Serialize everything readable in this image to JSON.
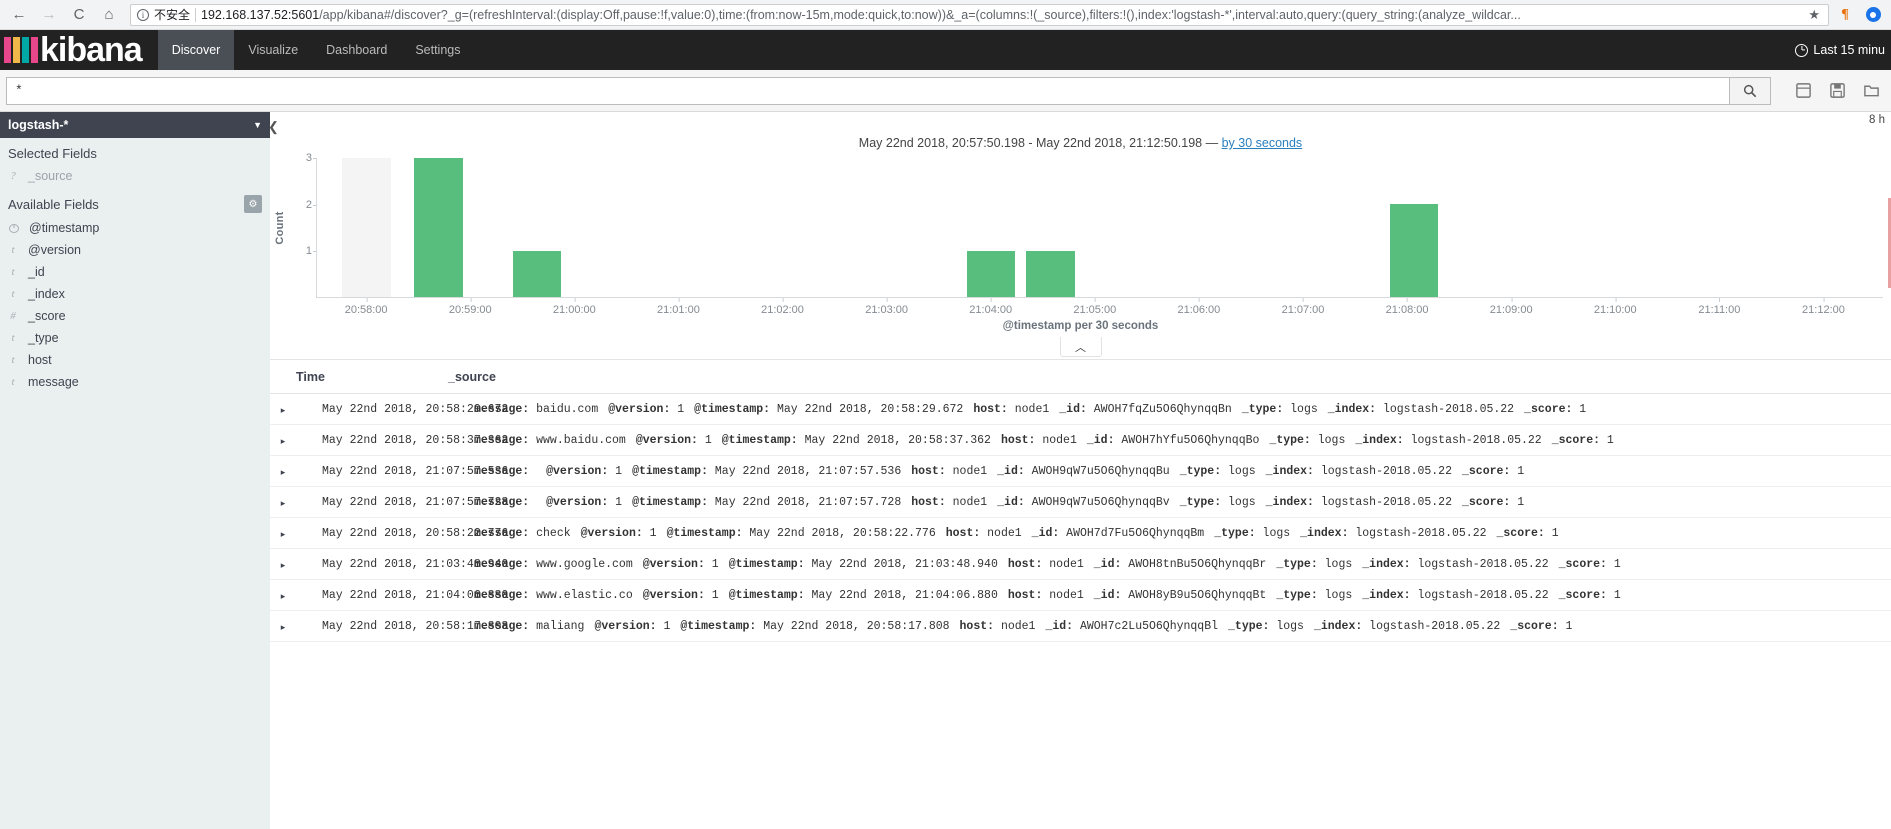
{
  "browser": {
    "back_icon": "back-arrow",
    "forward_icon": "forward-arrow",
    "reload_icon": "reload",
    "home_icon": "home",
    "insecure_label": "不安全",
    "url_host": "192.168.137.52:5601",
    "url_rest": "/app/kibana#/discover?_g=(refreshInterval:(display:Off,pause:!f,value:0),time:(from:now-15m,mode:quick,to:now))&_a=(columns:!(_source),filters:!(),index:'logstash-*',interval:auto,query:(query_string:(analyze_wildcar...",
    "star_icon": "★",
    "ext1_icon": "¶",
    "ext2_icon": "extension-blue"
  },
  "nav": {
    "logo_text": "kibana",
    "logo_colors": [
      "#e8488b",
      "#f0b849",
      "#00a9a5",
      "#e8488b",
      "#ffffff"
    ],
    "tabs": [
      {
        "label": "Discover",
        "active": true
      },
      {
        "label": "Visualize",
        "active": false
      },
      {
        "label": "Dashboard",
        "active": false
      },
      {
        "label": "Settings",
        "active": false
      }
    ],
    "time_picker": "Last 15 minu"
  },
  "search": {
    "value": "*",
    "placeholder": "",
    "go_icon": "search-icon",
    "actions": [
      {
        "name": "new-search-icon",
        "glyph": "▤"
      },
      {
        "name": "save-search-icon",
        "glyph": "▥"
      },
      {
        "name": "open-search-icon",
        "glyph": "▣"
      }
    ]
  },
  "sidebar": {
    "index_pattern": "logstash-*",
    "selected_fields_label": "Selected Fields",
    "available_fields_label": "Available Fields",
    "gear_icon": "gear-icon",
    "selected_fields": [
      {
        "type": "?",
        "name": "_source"
      }
    ],
    "available_fields": [
      {
        "type": "clock",
        "name": "@timestamp"
      },
      {
        "type": "t",
        "name": "@version"
      },
      {
        "type": "t",
        "name": "_id"
      },
      {
        "type": "t",
        "name": "_index"
      },
      {
        "type": "#",
        "name": "_score"
      },
      {
        "type": "t",
        "name": "_type"
      },
      {
        "type": "t",
        "name": "host"
      },
      {
        "type": "t",
        "name": "message"
      }
    ],
    "collapse_icon": "chevron-left-icon"
  },
  "chart_data": {
    "type": "bar",
    "title": "May 22nd 2018, 20:57:50.198 - May 22nd 2018, 21:12:50.198 — ",
    "title_link": "by 30 seconds",
    "range_start": "May 22nd 2018, 20:57:50.198",
    "range_end": "May 22nd 2018, 21:12:50.198",
    "interval_label": "by 30 seconds",
    "xlabel": "@timestamp per 30 seconds",
    "ylabel": "Count",
    "ylim": [
      0,
      3
    ],
    "yticks": [
      1,
      2,
      3
    ],
    "xticks": [
      "20:58:00",
      "20:59:00",
      "21:00:00",
      "21:01:00",
      "21:02:00",
      "21:03:00",
      "21:04:00",
      "21:05:00",
      "21:06:00",
      "21:07:00",
      "21:08:00",
      "21:09:00",
      "21:10:00",
      "21:11:00",
      "21:12:00"
    ],
    "x": [
      "20:58:00",
      "20:58:30",
      "20:59:00",
      "21:03:30",
      "21:04:00",
      "21:07:30"
    ],
    "values": [
      3,
      3,
      1,
      1,
      1,
      2
    ],
    "bar_color": "#57be7d",
    "hover_bar_color": "#f4f4f4",
    "grid": false,
    "bars": [
      {
        "x_pct": 1.6,
        "value": 3,
        "hover": true
      },
      {
        "x_pct": 6.2,
        "value": 3,
        "hover": false
      },
      {
        "x_pct": 12.5,
        "value": 1,
        "hover": false
      },
      {
        "x_pct": 41.5,
        "value": 1,
        "hover": false
      },
      {
        "x_pct": 45.3,
        "value": 1,
        "hover": false
      },
      {
        "x_pct": 68.5,
        "value": 2,
        "hover": false
      }
    ]
  },
  "collapse_chart_icon": "chevron-up-icon",
  "table": {
    "headers": {
      "time": "Time",
      "source": "_source"
    },
    "expand_icon": "▸",
    "rows": [
      {
        "time": "May 22nd 2018, 20:58:29.672",
        "fields": [
          {
            "k": "message:",
            "v": "baidu.com"
          },
          {
            "k": "@version:",
            "v": "1"
          },
          {
            "k": "@timestamp:",
            "v": "May 22nd 2018, 20:58:29.672"
          },
          {
            "k": "host:",
            "v": "node1"
          },
          {
            "k": "_id:",
            "v": "AWOH7fqZu5O6QhynqqBn"
          },
          {
            "k": "_type:",
            "v": "logs"
          },
          {
            "k": "_index:",
            "v": "logstash-2018.05.22"
          },
          {
            "k": "_score:",
            "v": "1"
          }
        ]
      },
      {
        "time": "May 22nd 2018, 20:58:37.362",
        "fields": [
          {
            "k": "message:",
            "v": "www.baidu.com"
          },
          {
            "k": "@version:",
            "v": "1"
          },
          {
            "k": "@timestamp:",
            "v": "May 22nd 2018, 20:58:37.362"
          },
          {
            "k": "host:",
            "v": "node1"
          },
          {
            "k": "_id:",
            "v": "AWOH7hYfu5O6QhynqqBo"
          },
          {
            "k": "_type:",
            "v": "logs"
          },
          {
            "k": "_index:",
            "v": "logstash-2018.05.22"
          },
          {
            "k": "_score:",
            "v": "1"
          }
        ]
      },
      {
        "time": "May 22nd 2018, 21:07:57.536",
        "fields": [
          {
            "k": "message:",
            "v": ""
          },
          {
            "k": "@version:",
            "v": "1"
          },
          {
            "k": "@timestamp:",
            "v": "May 22nd 2018, 21:07:57.536"
          },
          {
            "k": "host:",
            "v": "node1"
          },
          {
            "k": "_id:",
            "v": "AWOH9qW7u5O6QhynqqBu"
          },
          {
            "k": "_type:",
            "v": "logs"
          },
          {
            "k": "_index:",
            "v": "logstash-2018.05.22"
          },
          {
            "k": "_score:",
            "v": "1"
          }
        ]
      },
      {
        "time": "May 22nd 2018, 21:07:57.728",
        "fields": [
          {
            "k": "message:",
            "v": ""
          },
          {
            "k": "@version:",
            "v": "1"
          },
          {
            "k": "@timestamp:",
            "v": "May 22nd 2018, 21:07:57.728"
          },
          {
            "k": "host:",
            "v": "node1"
          },
          {
            "k": "_id:",
            "v": "AWOH9qW7u5O6QhynqqBv"
          },
          {
            "k": "_type:",
            "v": "logs"
          },
          {
            "k": "_index:",
            "v": "logstash-2018.05.22"
          },
          {
            "k": "_score:",
            "v": "1"
          }
        ]
      },
      {
        "time": "May 22nd 2018, 20:58:22.776",
        "fields": [
          {
            "k": "message:",
            "v": "check"
          },
          {
            "k": "@version:",
            "v": "1"
          },
          {
            "k": "@timestamp:",
            "v": "May 22nd 2018, 20:58:22.776"
          },
          {
            "k": "host:",
            "v": "node1"
          },
          {
            "k": "_id:",
            "v": "AWOH7d7Fu5O6QhynqqBm"
          },
          {
            "k": "_type:",
            "v": "logs"
          },
          {
            "k": "_index:",
            "v": "logstash-2018.05.22"
          },
          {
            "k": "_score:",
            "v": "1"
          }
        ]
      },
      {
        "time": "May 22nd 2018, 21:03:48.940",
        "fields": [
          {
            "k": "message:",
            "v": "www.google.com"
          },
          {
            "k": "@version:",
            "v": "1"
          },
          {
            "k": "@timestamp:",
            "v": "May 22nd 2018, 21:03:48.940"
          },
          {
            "k": "host:",
            "v": "node1"
          },
          {
            "k": "_id:",
            "v": "AWOH8tnBu5O6QhynqqBr"
          },
          {
            "k": "_type:",
            "v": "logs"
          },
          {
            "k": "_index:",
            "v": "logstash-2018.05.22"
          },
          {
            "k": "_score:",
            "v": "1"
          }
        ]
      },
      {
        "time": "May 22nd 2018, 21:04:06.880",
        "fields": [
          {
            "k": "message:",
            "v": "www.elastic.co"
          },
          {
            "k": "@version:",
            "v": "1"
          },
          {
            "k": "@timestamp:",
            "v": "May 22nd 2018, 21:04:06.880"
          },
          {
            "k": "host:",
            "v": "node1"
          },
          {
            "k": "_id:",
            "v": "AWOH8yB9u5O6QhynqqBt"
          },
          {
            "k": "_type:",
            "v": "logs"
          },
          {
            "k": "_index:",
            "v": "logstash-2018.05.22"
          },
          {
            "k": "_score:",
            "v": "1"
          }
        ]
      },
      {
        "time": "May 22nd 2018, 20:58:17.808",
        "fields": [
          {
            "k": "message:",
            "v": "maliang"
          },
          {
            "k": "@version:",
            "v": "1"
          },
          {
            "k": "@timestamp:",
            "v": "May 22nd 2018, 20:58:17.808"
          },
          {
            "k": "host:",
            "v": "node1"
          },
          {
            "k": "_id:",
            "v": "AWOH7c2Lu5O6QhynqqBl"
          },
          {
            "k": "_type:",
            "v": "logs"
          },
          {
            "k": "_index:",
            "v": "logstash-2018.05.22"
          },
          {
            "k": "_score:",
            "v": "1"
          }
        ]
      }
    ]
  },
  "right_edge_text": "8 h"
}
